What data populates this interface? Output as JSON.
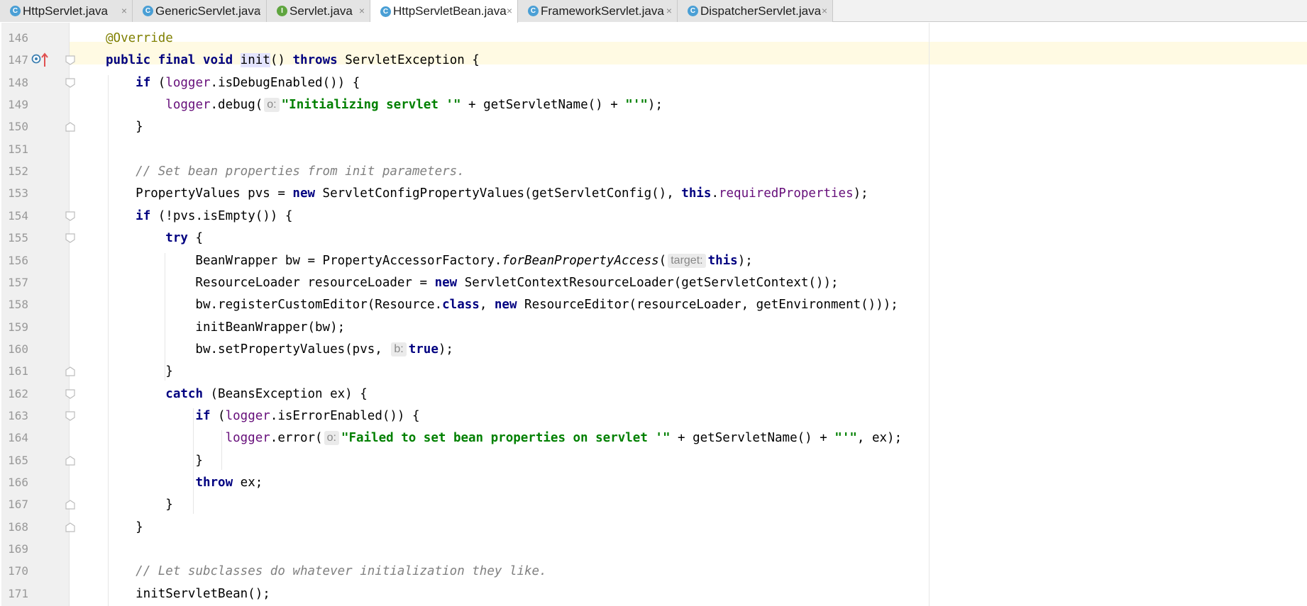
{
  "tabs": [
    {
      "label": "HttpServlet.java",
      "type": "class",
      "active": false
    },
    {
      "label": "GenericServlet.java",
      "type": "class",
      "active": false
    },
    {
      "label": "Servlet.java",
      "type": "interface",
      "active": false
    },
    {
      "label": "HttpServletBean.java",
      "type": "class",
      "active": true
    },
    {
      "label": "FrameworkServlet.java",
      "type": "class",
      "active": false
    },
    {
      "label": "DispatcherServlet.java",
      "type": "class",
      "active": false
    }
  ],
  "tab_close_glyph": "×",
  "tab_icon_letters": {
    "class": "C",
    "interface": "I"
  },
  "colors": {
    "class_icon": "#4a9fd5",
    "interface_icon": "#5fa53f",
    "keyword": "#000080",
    "string": "#008000",
    "field": "#660e7a",
    "comment": "#808080",
    "annotation": "#808000",
    "current_line": "#fffae3",
    "gutter": "#f0f0f0",
    "line_number": "#999999"
  },
  "gutter_icons": {
    "line_147": [
      "override-marker-icon",
      "implementing-arrow-icon"
    ]
  },
  "editor": {
    "lines": [
      {
        "n": "146",
        "tokens": [
          {
            "t": "@Override",
            "c": "ann"
          }
        ]
      },
      {
        "n": "147",
        "tokens": [
          {
            "t": "public final void",
            "c": "kw"
          },
          {
            "t": " "
          },
          {
            "t": "init",
            "c": "sym"
          },
          {
            "t": "() "
          },
          {
            "t": "throws",
            "c": "kw"
          },
          {
            "t": " ServletException {"
          }
        ]
      },
      {
        "n": "148",
        "tokens": [
          {
            "t": "    "
          },
          {
            "t": "if",
            "c": "kw"
          },
          {
            "t": " ("
          },
          {
            "t": "logger",
            "c": "fld"
          },
          {
            "t": ".isDebugEnabled()) {"
          }
        ]
      },
      {
        "n": "149",
        "tokens": [
          {
            "t": "        "
          },
          {
            "t": "logger",
            "c": "fld"
          },
          {
            "t": ".debug("
          },
          {
            "hint": "o:"
          },
          {
            "t": "\"Initializing servlet '\"",
            "c": "str"
          },
          {
            "t": " + getServletName() + "
          },
          {
            "t": "\"'\"",
            "c": "str"
          },
          {
            "t": ");"
          }
        ]
      },
      {
        "n": "150",
        "tokens": [
          {
            "t": "    }"
          }
        ]
      },
      {
        "n": "151",
        "tokens": []
      },
      {
        "n": "152",
        "tokens": [
          {
            "t": "    "
          },
          {
            "t": "// Set bean properties from init parameters.",
            "c": "cmt"
          }
        ]
      },
      {
        "n": "153",
        "tokens": [
          {
            "t": "    PropertyValues pvs = "
          },
          {
            "t": "new",
            "c": "kw"
          },
          {
            "t": " ServletConfigPropertyValues(getServletConfig(), "
          },
          {
            "t": "this",
            "c": "kw"
          },
          {
            "t": "."
          },
          {
            "t": "requiredProperties",
            "c": "fld"
          },
          {
            "t": ");"
          }
        ]
      },
      {
        "n": "154",
        "tokens": [
          {
            "t": "    "
          },
          {
            "t": "if",
            "c": "kw"
          },
          {
            "t": " (!pvs.isEmpty()) {"
          }
        ]
      },
      {
        "n": "155",
        "tokens": [
          {
            "t": "        "
          },
          {
            "t": "try",
            "c": "kw"
          },
          {
            "t": " {"
          }
        ]
      },
      {
        "n": "156",
        "tokens": [
          {
            "t": "            BeanWrapper bw = PropertyAccessorFactory."
          },
          {
            "t": "forBeanPropertyAccess",
            "c": "ital"
          },
          {
            "t": "("
          },
          {
            "hint": "target:"
          },
          {
            "t": "this",
            "c": "kw"
          },
          {
            "t": ");"
          }
        ]
      },
      {
        "n": "157",
        "tokens": [
          {
            "t": "            ResourceLoader resourceLoader = "
          },
          {
            "t": "new",
            "c": "kw"
          },
          {
            "t": " ServletContextResourceLoader(getServletContext());"
          }
        ]
      },
      {
        "n": "158",
        "tokens": [
          {
            "t": "            bw.registerCustomEditor(Resource."
          },
          {
            "t": "class",
            "c": "kw"
          },
          {
            "t": ", "
          },
          {
            "t": "new",
            "c": "kw"
          },
          {
            "t": " ResourceEditor(resourceLoader, getEnvironment()));"
          }
        ]
      },
      {
        "n": "159",
        "tokens": [
          {
            "t": "            initBeanWrapper(bw);"
          }
        ]
      },
      {
        "n": "160",
        "tokens": [
          {
            "t": "            bw.setPropertyValues(pvs, "
          },
          {
            "hint": "b:"
          },
          {
            "t": "true",
            "c": "kw"
          },
          {
            "t": ");"
          }
        ]
      },
      {
        "n": "161",
        "tokens": [
          {
            "t": "        }"
          }
        ]
      },
      {
        "n": "162",
        "tokens": [
          {
            "t": "        "
          },
          {
            "t": "catch",
            "c": "kw"
          },
          {
            "t": " (BeansException ex) {"
          }
        ]
      },
      {
        "n": "163",
        "tokens": [
          {
            "t": "            "
          },
          {
            "t": "if",
            "c": "kw"
          },
          {
            "t": " ("
          },
          {
            "t": "logger",
            "c": "fld"
          },
          {
            "t": ".isErrorEnabled()) {"
          }
        ]
      },
      {
        "n": "164",
        "tokens": [
          {
            "t": "                "
          },
          {
            "t": "logger",
            "c": "fld"
          },
          {
            "t": ".error("
          },
          {
            "hint": "o:"
          },
          {
            "t": "\"Failed to set bean properties on servlet '\"",
            "c": "str"
          },
          {
            "t": " + getServletName() + "
          },
          {
            "t": "\"'\"",
            "c": "str"
          },
          {
            "t": ", ex);"
          }
        ]
      },
      {
        "n": "165",
        "tokens": [
          {
            "t": "            }"
          }
        ]
      },
      {
        "n": "166",
        "tokens": [
          {
            "t": "            "
          },
          {
            "t": "throw",
            "c": "kw"
          },
          {
            "t": " ex;"
          }
        ]
      },
      {
        "n": "167",
        "tokens": [
          {
            "t": "        }"
          }
        ]
      },
      {
        "n": "168",
        "tokens": [
          {
            "t": "    }"
          }
        ]
      },
      {
        "n": "169",
        "tokens": []
      },
      {
        "n": "170",
        "tokens": [
          {
            "t": "    "
          },
          {
            "t": "// Let subclasses do whatever initialization they like.",
            "c": "cmt"
          }
        ]
      },
      {
        "n": "171",
        "tokens": [
          {
            "t": "    initServletBean();"
          }
        ]
      }
    ],
    "current_line": "147",
    "fold_markers": [
      {
        "line": "147",
        "kind": "open"
      },
      {
        "line": "148",
        "kind": "open"
      },
      {
        "line": "150",
        "kind": "close"
      },
      {
        "line": "154",
        "kind": "open"
      },
      {
        "line": "155",
        "kind": "open"
      },
      {
        "line": "161",
        "kind": "close"
      },
      {
        "line": "162",
        "kind": "open"
      },
      {
        "line": "163",
        "kind": "open"
      },
      {
        "line": "165",
        "kind": "close"
      },
      {
        "line": "167",
        "kind": "close"
      },
      {
        "line": "168",
        "kind": "close"
      }
    ]
  }
}
